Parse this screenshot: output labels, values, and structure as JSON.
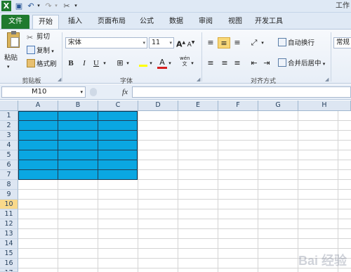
{
  "window": {
    "title": "工作"
  },
  "tabs": [
    "文件",
    "开始",
    "插入",
    "页面布局",
    "公式",
    "数据",
    "审阅",
    "视图",
    "开发工具"
  ],
  "clipboard": {
    "paste": "粘贴",
    "cut": "剪切",
    "copy": "复制",
    "format_painter": "格式刷",
    "group": "剪贴板"
  },
  "font": {
    "name": "宋体",
    "size": "11",
    "grow": "A",
    "shrink": "A",
    "bold": "B",
    "italic": "I",
    "underline": "U",
    "color_letter": "A",
    "wen": "wén",
    "group": "字体"
  },
  "alignment": {
    "wrap_text": "自动换行",
    "merge_center": "合并后居中",
    "group": "对齐方式"
  },
  "number": {
    "format": "常规"
  },
  "formula_bar": {
    "name_box": "M10",
    "fx": "fx",
    "value": ""
  },
  "sheet": {
    "columns": [
      "A",
      "B",
      "C",
      "D",
      "E",
      "F",
      "G",
      "H"
    ],
    "rows": [
      "1",
      "2",
      "3",
      "4",
      "5",
      "6",
      "7",
      "8",
      "9",
      "10",
      "11",
      "12",
      "13",
      "14",
      "15",
      "16",
      "17"
    ],
    "selected_row": "10",
    "fill_color": "#0aa7e2",
    "filled_range": "A1:C7"
  },
  "watermark": "Bai 经验",
  "colors": {
    "file_tab": "#1f7a2e",
    "selected_header": "#f9d98b",
    "cell_fill": "#0aa7e2"
  }
}
